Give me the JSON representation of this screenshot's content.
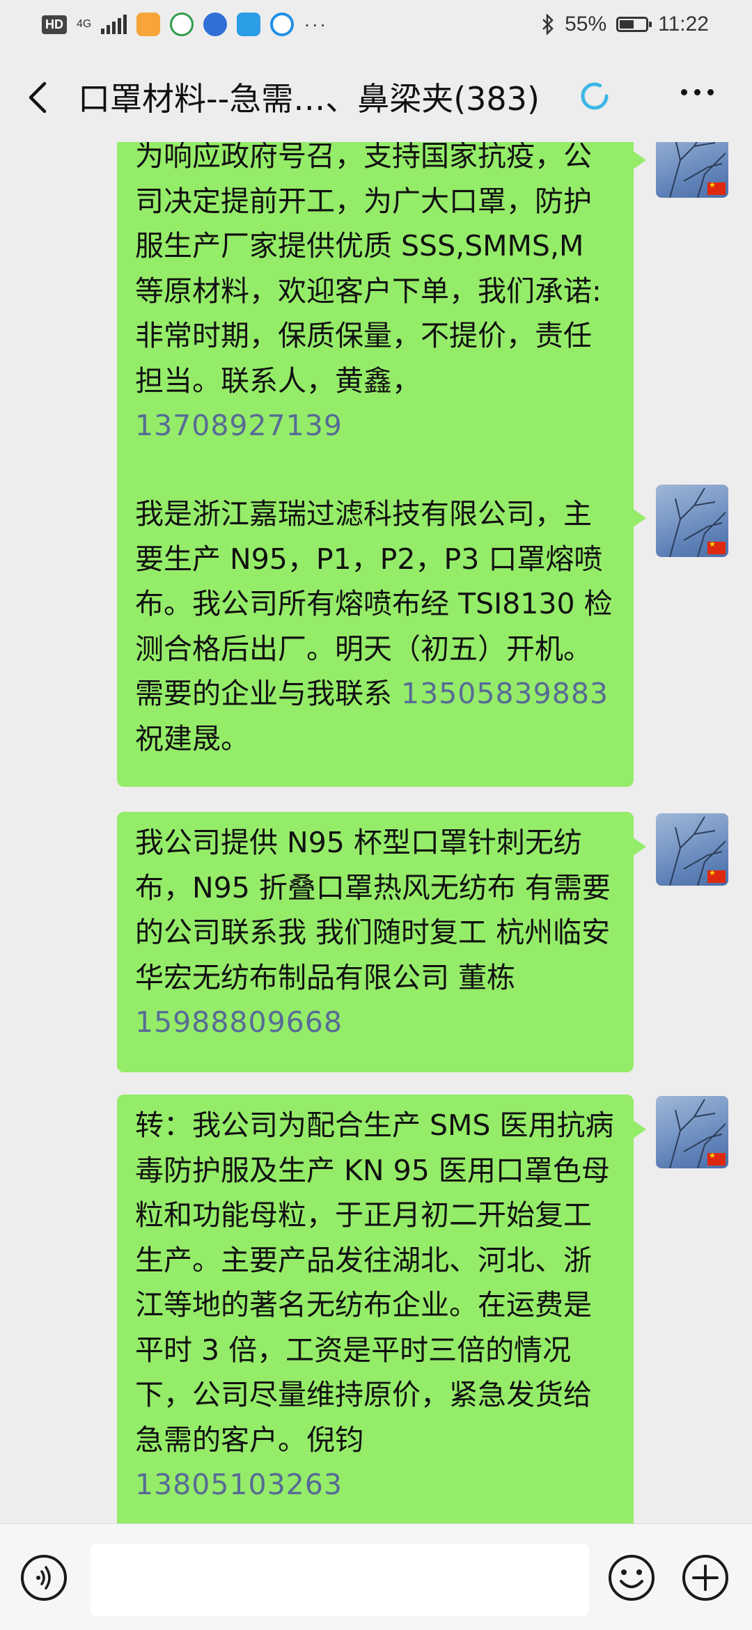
{
  "status_bar": {
    "hd": "HD",
    "network": "4G",
    "icons": [
      "weibo-icon",
      "qq-browser-icon",
      "baidu-icon",
      "feishu-icon",
      "circle-app-icon"
    ],
    "more": "···",
    "bluetooth": "bluetooth-icon",
    "battery": "55%",
    "battery_level": 0.55,
    "time": "11:22"
  },
  "header": {
    "title": "口罩材料--急需…、鼻梁夹(383)",
    "back_icon": "chevron-left-icon",
    "loading_icon": "loading-ring-icon",
    "more_icon": "more-dots-icon"
  },
  "messages": [
    {
      "text": "为响应政府号召，支持国家抗疫，公司决定提前开工，为广大口罩，防护服生产厂家提供优质 SSS,SMMS,M 等原材料，欢迎客户下单，我们承诺:非常时期，保质保量，不提价，责任担当。联系人，黄鑫，",
      "phone": "13708927139",
      "suffix": ""
    },
    {
      "text": "我是浙江嘉瑞过滤科技有限公司，主要生产 N95，P1，P2，P3 口罩熔喷布。我公司所有熔喷布经 TSI8130 检测合格后出厂。明天（初五）开机。需要的企业与我联系",
      "phone": "13505839883",
      "suffix": " 祝建晟。"
    },
    {
      "text": "我公司提供 N95 杯型口罩针刺无纺布，N95 折叠口罩热风无纺布 有需要的公司联系我 我们随时复工 杭州临安华宏无纺布制品有限公司 董栋",
      "phone": "15988809668",
      "suffix": ""
    },
    {
      "text": "转：我公司为配合生产 SMS 医用抗病毒防护服及生产 KN 95 医用口罩色母粒和功能母粒，于正月初二开始复工生产。主要产品发往湖北、河北、浙江等地的著名无纺布企业。在运费是平时 3 倍，工资是平时三倍的情况下，公司尽量维持原价，紧急发货给急需的客户。倪钧",
      "phone": "13805103263",
      "suffix": ""
    }
  ],
  "input_bar": {
    "voice_icon": "voice-icon",
    "emoji_icon": "emoji-icon",
    "plus_icon": "plus-icon"
  }
}
